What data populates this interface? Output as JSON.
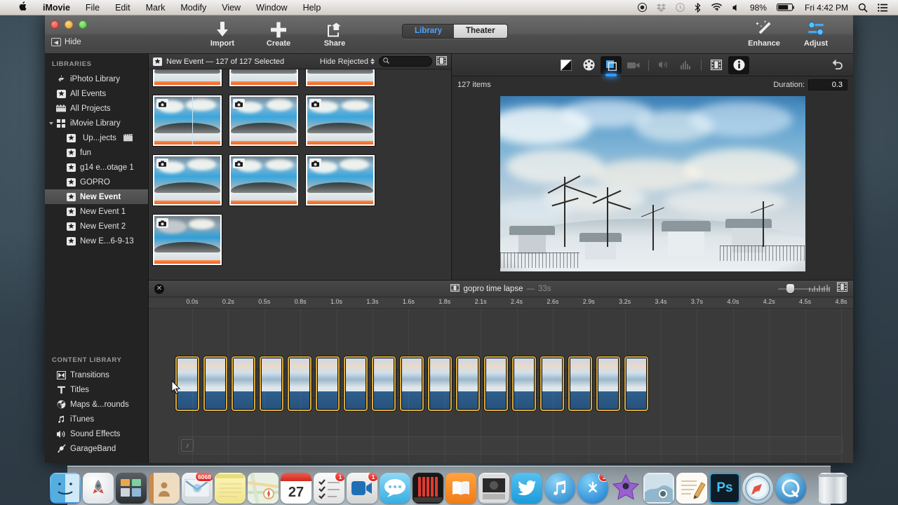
{
  "menubar": {
    "apple": "apple-logo",
    "items": [
      "iMovie",
      "File",
      "Edit",
      "Mark",
      "Modify",
      "View",
      "Window",
      "Help"
    ],
    "status": {
      "battery_pct": "98%",
      "clock": "Fri 4:42 PM",
      "icons": [
        "record-icon",
        "dropbox-icon",
        "timemachine-icon",
        "bluetooth-icon",
        "wifi-icon",
        "volume-icon",
        "battery-icon",
        "spotlight-icon",
        "notification-center-icon"
      ]
    }
  },
  "window": {
    "traffic": [
      "close-button",
      "minimize-button",
      "zoom-button"
    ],
    "hide_label": "Hide",
    "toolbar": {
      "import_label": "Import",
      "create_label": "Create",
      "share_label": "Share",
      "enhance_label": "Enhance",
      "adjust_label": "Adjust",
      "tabs": [
        {
          "label": "Library",
          "active": true
        },
        {
          "label": "Theater",
          "active": false
        }
      ]
    }
  },
  "sidebar": {
    "libraries_header": "LIBRARIES",
    "libraries": [
      {
        "label": "iPhoto Library",
        "icon": "iphoto-icon",
        "indent": false,
        "selected": false
      },
      {
        "label": "All Events",
        "icon": "star-icon",
        "indent": false,
        "selected": false
      },
      {
        "label": "All Projects",
        "icon": "filmstrip-icon",
        "indent": false,
        "selected": false
      },
      {
        "label": "iMovie Library",
        "icon": "library-icon",
        "indent": false,
        "selected": false,
        "disclosure": true
      },
      {
        "label": "Up...jects",
        "icon": "star-icon",
        "indent": true,
        "selected": false,
        "trailing_icon": "clapper-icon"
      },
      {
        "label": "fun",
        "icon": "star-icon",
        "indent": true,
        "selected": false
      },
      {
        "label": "g14 e...otage 1",
        "icon": "star-icon",
        "indent": true,
        "selected": false
      },
      {
        "label": "GOPRO",
        "icon": "star-icon",
        "indent": true,
        "selected": false
      },
      {
        "label": "New Event",
        "icon": "star-icon",
        "indent": true,
        "selected": true
      },
      {
        "label": "New Event 1",
        "icon": "star-icon",
        "indent": true,
        "selected": false
      },
      {
        "label": "New Event 2",
        "icon": "star-icon",
        "indent": true,
        "selected": false
      },
      {
        "label": "New E...6-9-13",
        "icon": "star-icon",
        "indent": true,
        "selected": false
      }
    ],
    "content_header": "CONTENT LIBRARY",
    "content": [
      {
        "label": "Transitions",
        "icon": "transitions-icon"
      },
      {
        "label": "Titles",
        "icon": "titles-icon"
      },
      {
        "label": "Maps &...rounds",
        "icon": "globe-icon"
      },
      {
        "label": "iTunes",
        "icon": "music-note-icon"
      },
      {
        "label": "Sound Effects",
        "icon": "speaker-icon"
      },
      {
        "label": "GarageBand",
        "icon": "guitar-icon"
      }
    ]
  },
  "browser": {
    "title": "New Event — 127 of 127 Selected",
    "event_icon": "star-icon",
    "filter_label": "Hide Rejected",
    "search_placeholder": "",
    "search_value": "",
    "search_icon": "search-icon",
    "view_icon": "filmstrip-view-icon",
    "rows": [
      {
        "count": 3,
        "partial": true
      },
      {
        "count": 3,
        "partial": false,
        "playhead_on_first": true
      },
      {
        "count": 3,
        "partial": false
      },
      {
        "count": 1,
        "partial": false
      }
    ]
  },
  "viewer": {
    "tools": [
      {
        "name": "color-balance-icon",
        "state": "normal"
      },
      {
        "name": "color-correction-icon",
        "state": "normal"
      },
      {
        "name": "crop-icon",
        "state": "selected"
      },
      {
        "name": "stabilization-icon",
        "state": "disabled"
      },
      {
        "name": "volume-icon",
        "state": "disabled"
      },
      {
        "name": "equalizer-icon",
        "state": "disabled"
      },
      {
        "name": "clip-filter-icon",
        "state": "normal"
      },
      {
        "name": "info-icon",
        "state": "active"
      }
    ],
    "undo_icon": "undo-icon",
    "items_label": "127 items",
    "duration_label": "Duration:",
    "duration_value": "0.3"
  },
  "timeline": {
    "close_icon": "close-icon",
    "project_icon": "project-icon",
    "title": "gopro time lapse",
    "dash": "—",
    "duration": "33s",
    "zoom_icon": "zoom-slider",
    "filmstrip_icon": "filmstrip-settings-icon",
    "ruler_ticks": [
      "0.0s",
      "0.2s",
      "0.5s",
      "0.8s",
      "1.0s",
      "1.3s",
      "1.6s",
      "1.8s",
      "2.1s",
      "2.4s",
      "2.6s",
      "2.9s",
      "3.2s",
      "3.4s",
      "3.7s",
      "4.0s",
      "4.2s",
      "4.5s",
      "4.8s"
    ],
    "clip_count": 17,
    "audio_track_icon": "music-note-icon"
  },
  "dock": {
    "items": [
      {
        "name": "finder",
        "badge": null,
        "running": true
      },
      {
        "name": "launchpad",
        "badge": null,
        "running": false
      },
      {
        "name": "mission-control",
        "badge": null,
        "running": false
      },
      {
        "name": "contacts",
        "badge": null,
        "running": false
      },
      {
        "name": "mail",
        "badge": "6068",
        "running": false
      },
      {
        "name": "notes",
        "badge": null,
        "running": false
      },
      {
        "name": "maps",
        "badge": null,
        "running": false
      },
      {
        "name": "calendar",
        "badge": "27",
        "running": false
      },
      {
        "name": "reminders",
        "badge": "1",
        "running": false
      },
      {
        "name": "facetime",
        "badge": "1",
        "running": false
      },
      {
        "name": "messages",
        "badge": null,
        "running": false
      },
      {
        "name": "itunes-store",
        "badge": null,
        "running": false
      },
      {
        "name": "ibooks",
        "badge": null,
        "running": false
      },
      {
        "name": "photo-booth",
        "badge": null,
        "running": false
      },
      {
        "name": "twitter",
        "badge": null,
        "running": false
      },
      {
        "name": "itunes",
        "badge": null,
        "running": false
      },
      {
        "name": "app-store",
        "badge": "1",
        "running": false
      },
      {
        "name": "imovie",
        "badge": null,
        "running": true
      },
      {
        "name": "iphoto",
        "badge": null,
        "running": false
      },
      {
        "name": "pages",
        "badge": null,
        "running": false
      },
      {
        "name": "photoshop",
        "badge": null,
        "running": false
      },
      {
        "name": "safari",
        "badge": null,
        "running": false
      },
      {
        "name": "quicktime",
        "badge": null,
        "running": false
      },
      {
        "name": "trash",
        "badge": null,
        "running": false
      }
    ]
  }
}
